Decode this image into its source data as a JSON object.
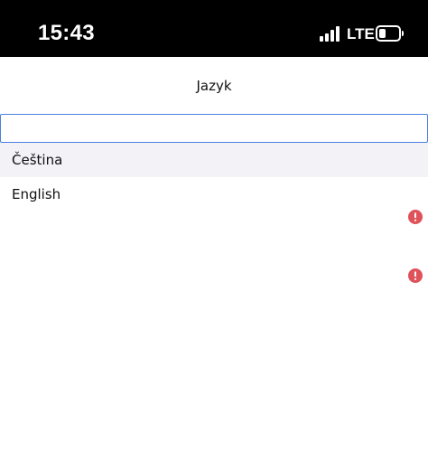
{
  "status_bar": {
    "time": "15:43",
    "network": "LTE",
    "signal_bars": 4,
    "battery_level": 0.25
  },
  "header": {
    "title": "Jazyk"
  },
  "search": {
    "value": "",
    "placeholder": ""
  },
  "languages": [
    {
      "label": "Čeština",
      "selected": true
    },
    {
      "label": "English",
      "selected": false
    }
  ],
  "indicators": {
    "error_icon": "error-circle-icon",
    "error_color": "#e0525a"
  },
  "colors": {
    "status_bar": "#000000",
    "input_border": "#4a7fe0",
    "selected_row": "#f2f2f7"
  }
}
